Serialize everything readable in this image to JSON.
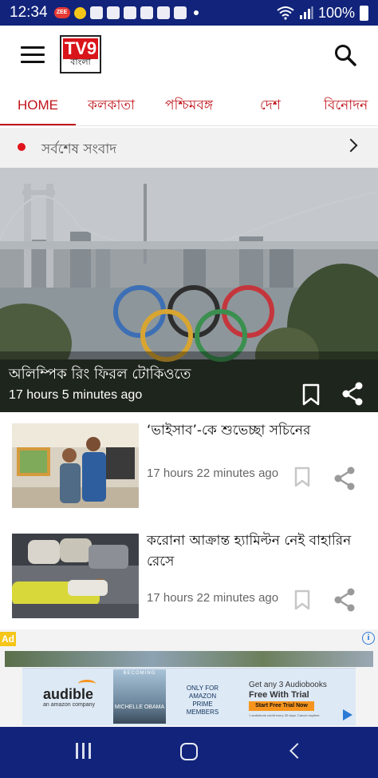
{
  "status_bar": {
    "time": "12:34",
    "zee_badge": "ZEE",
    "battery_percent": "100%"
  },
  "app_bar": {
    "logo_top": "TV9",
    "logo_bottom": "বাংলা",
    "menu_icon": "hamburger-icon",
    "search_icon": "search-icon"
  },
  "tabs": [
    {
      "label": "HOME",
      "active": true
    },
    {
      "label": "কলকাতা",
      "active": false
    },
    {
      "label": "পশ্চিমবঙ্গ",
      "active": false
    },
    {
      "label": "দেশ",
      "active": false
    },
    {
      "label": "বিনোদন",
      "active": false
    }
  ],
  "latest_news_label": "সর্বশেষ সংবাদ",
  "hero": {
    "title": "অলিম্পিক রিং ফিরল টোকিওতে",
    "time": "17 hours 5 minutes ago"
  },
  "news": [
    {
      "title": "‘ভাইসাব’-কে শুভেচ্ছা সচিনের",
      "time": "17 hours 22 minutes ago"
    },
    {
      "title": "করোনা আক্রান্ত হ্যামিল্টন নেই বাহারিন রেসে",
      "time": "17 hours 22 minutes ago"
    }
  ],
  "ad": {
    "tag": "Ad",
    "brand": "audible",
    "brand_sub": "an amazon company",
    "book_title": "BECOMING",
    "book_author": "MICHELLE OBAMA",
    "prime_text": "ONLY FOR AMAZON PRIME MEMBERS",
    "offer_line1": "Get any 3 Audiobooks",
    "offer_line2": "Free With Trial",
    "cta": "Start Free Trial Now",
    "fine_print": "1 audiobook credit every 30 days. Cancel anytime."
  },
  "colors": {
    "brand_red": "#c0141a",
    "system_bar": "#11237a"
  }
}
